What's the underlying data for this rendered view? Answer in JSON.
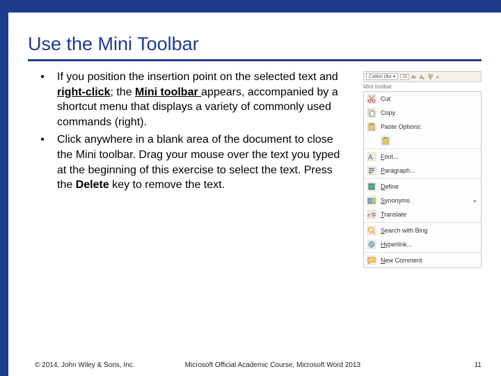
{
  "title": "Use the Mini Toolbar",
  "bullets": [
    {
      "marker": "•",
      "parts": [
        {
          "t": "If you position the insertion point on the selected text and "
        },
        {
          "t": "right-click",
          "b": true,
          "u": true
        },
        {
          "t": "; the "
        },
        {
          "t": "Mini toolbar ",
          "b": true,
          "u": true
        },
        {
          "t": "appears, accompanied by a shortcut menu that displays a variety of commonly used commands (right)."
        }
      ]
    },
    {
      "marker": "•",
      "parts": [
        {
          "t": "Click anywhere in a blank area of the document to close the Mini toolbar. Drag your mouse over the text you typed at the beginning of this exercise to select the text. Press the "
        },
        {
          "t": "Delete",
          "b": true
        },
        {
          "t": " key to remove the text."
        }
      ]
    }
  ],
  "mini_toolbar": {
    "font": "Calibri (Bo",
    "size": "11",
    "label": "Mini toolbar"
  },
  "context_menu": [
    {
      "icon": "cut",
      "label": "Cut"
    },
    {
      "icon": "copy",
      "label": "Copy"
    },
    {
      "icon": "paste",
      "label": "Paste Options:",
      "sub": true
    },
    {
      "sep": true
    },
    {
      "icon": "font",
      "label": "Font...",
      "u": true
    },
    {
      "icon": "para",
      "label": "Paragraph...",
      "u": true
    },
    {
      "sep": true
    },
    {
      "icon": "define",
      "label": "Define",
      "u": true
    },
    {
      "icon": "syn",
      "label": "Synonyms",
      "u": true,
      "arrow": true
    },
    {
      "icon": "trans",
      "label": "Translate",
      "u": true
    },
    {
      "sep": true
    },
    {
      "icon": "bing",
      "label": "Search with Bing",
      "u": true
    },
    {
      "icon": "link",
      "label": "Hyperlink...",
      "u": true
    },
    {
      "sep": true
    },
    {
      "icon": "comment",
      "label": "New Comment",
      "u": true
    }
  ],
  "footer": {
    "copyright": "© 2014, John Wiley & Sons, Inc.",
    "course": "Microsoft Official Academic Course, Microsoft Word 2013",
    "page": "11"
  }
}
